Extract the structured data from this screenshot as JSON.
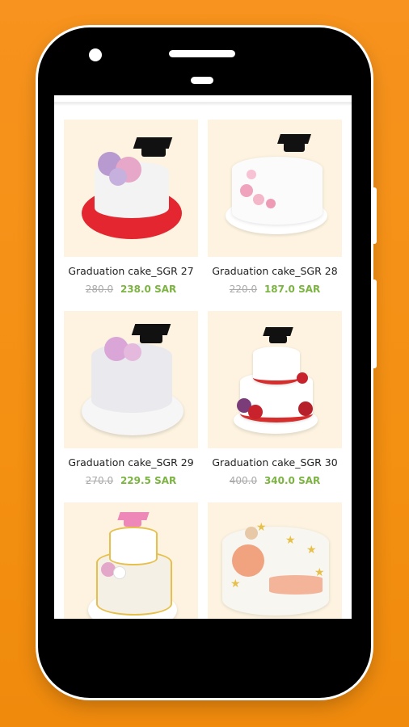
{
  "products": [
    {
      "title": "Graduation cake_SGR 27",
      "old_price": "280.0",
      "new_price": "238.0 SAR",
      "image": "cake-27"
    },
    {
      "title": "Graduation cake_SGR 28",
      "old_price": "220.0",
      "new_price": "187.0 SAR",
      "image": "cake-28"
    },
    {
      "title": "Graduation cake_SGR 29",
      "old_price": "270.0",
      "new_price": "229.5 SAR",
      "image": "cake-29"
    },
    {
      "title": "Graduation cake_SGR 30",
      "old_price": "400.0",
      "new_price": "340.0 SAR",
      "image": "cake-30"
    },
    {
      "title": "",
      "old_price": "",
      "new_price": "",
      "image": "cake-31"
    },
    {
      "title": "",
      "old_price": "",
      "new_price": "",
      "image": "cake-32"
    }
  ],
  "colors": {
    "background": "#f7931e",
    "price_new": "#7cb342",
    "price_old": "#aaaaaa",
    "card_bg": "#fdf3e0"
  }
}
